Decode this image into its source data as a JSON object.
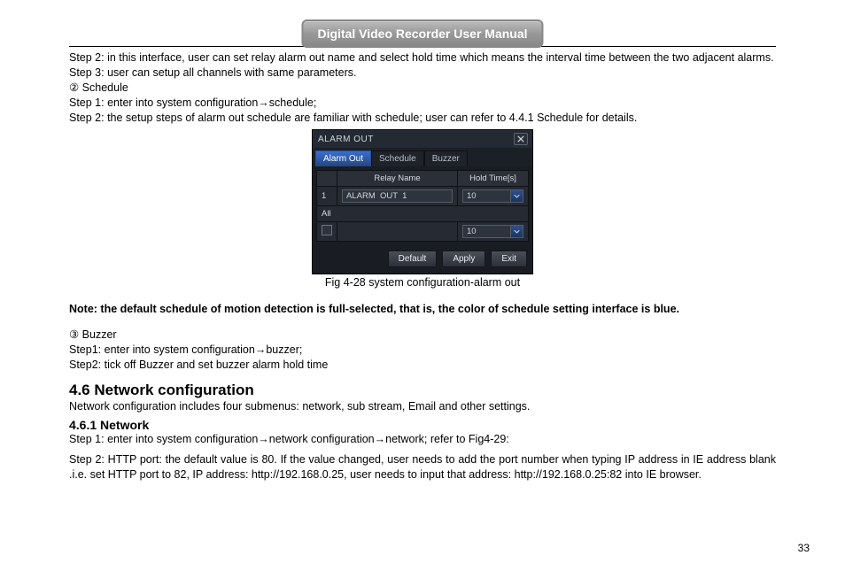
{
  "header": {
    "title": "Digital Video Recorder User Manual"
  },
  "text": {
    "p1": "Step 2: in this interface, user can set relay alarm out name and select hold time which means the interval time between the two adjacent alarms.",
    "p2": "Step 3: user can setup all channels with same parameters.",
    "p3": "②    Schedule",
    "p4": "Step 1: enter into system configuration→schedule;",
    "p5": "Step 2: the setup steps of alarm out schedule are familiar with schedule; user can refer to 4.4.1 Schedule for details.",
    "fig_caption": "Fig 4-28 system configuration-alarm out",
    "note": "Note: the default schedule of motion detection is full-selected, that is, the color of schedule setting interface is blue.",
    "p6": "③    Buzzer",
    "p7": "Step1: enter into system configuration→buzzer;",
    "p8": "Step2: tick off Buzzer and set buzzer alarm hold time",
    "h_sec": "4.6  Network configuration",
    "p9": "Network configuration includes four submenus: network, sub stream, Email and other settings.",
    "h_sub": "4.6.1  Network",
    "p10": "Step 1: enter into system configuration→network configuration→network; refer to Fig4-29:",
    "p11": "Step 2: HTTP port: the default value is 80. If the value changed, user needs to add the port number when typing IP address in IE address blank .i.e. set HTTP port to 82, IP address: http://192.168.0.25, user needs to input that address: http://192.168.0.25:82 into IE browser."
  },
  "dialog": {
    "title": "ALARM  OUT",
    "tabs": {
      "t1": "Alarm Out",
      "t2": "Schedule",
      "t3": "Buzzer"
    },
    "cols": {
      "relay": "Relay  Name",
      "hold": "Hold  Time[s]"
    },
    "rows": {
      "r1_idx": "1",
      "r1_name": "ALARM  OUT  1",
      "r1_hold": "10",
      "all": "All",
      "all_hold": "10"
    },
    "buttons": {
      "default": "Default",
      "apply": "Apply",
      "exit": "Exit"
    }
  },
  "page_number": "33"
}
